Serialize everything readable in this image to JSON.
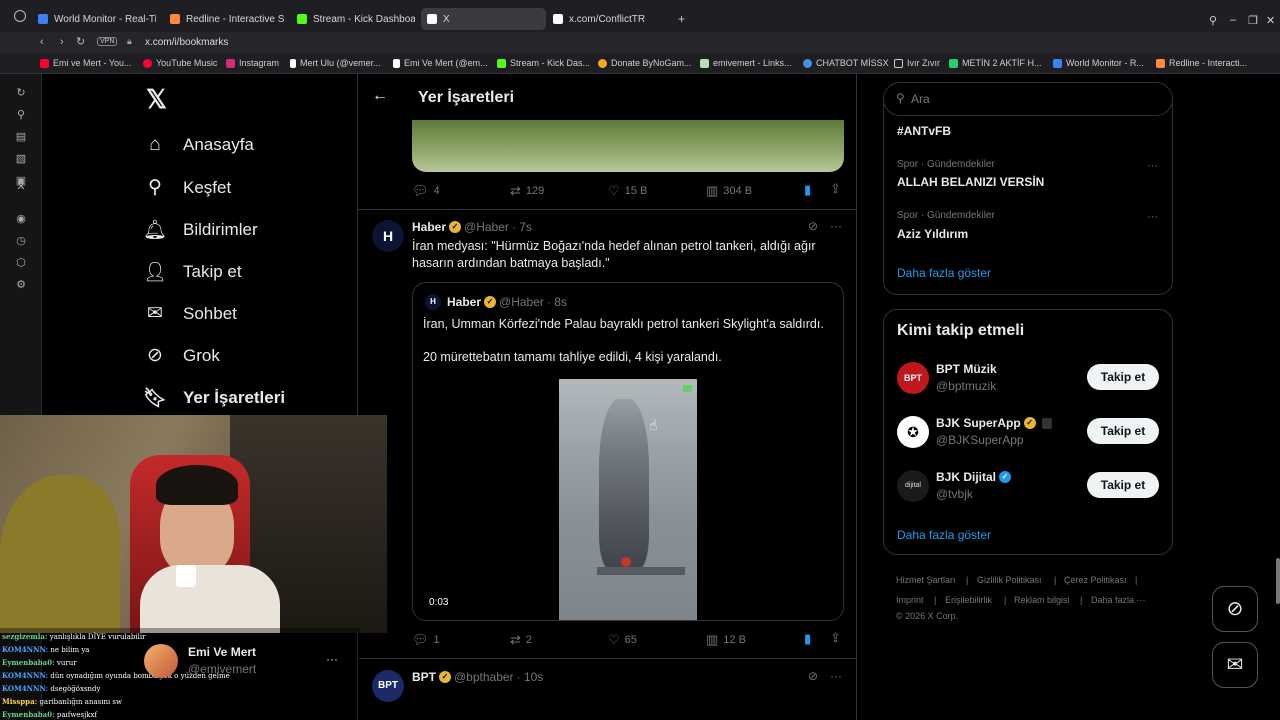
{
  "browser": {
    "tabs": [
      {
        "label": "World Monitor - Real-Tim",
        "color": "#3b82f6"
      },
      {
        "label": "Redline - Interactive Strat",
        "color": "#ff8a3d"
      },
      {
        "label": "Stream - Kick Dashboard",
        "color": "#53fc18"
      },
      {
        "label": "X",
        "color": "#ffffff"
      },
      {
        "label": "x.com/ConflictTR",
        "color": "#ffffff"
      }
    ],
    "new_tab": "+",
    "url": "x.com/i/bookmarks",
    "vpn": "VPN",
    "bookmarks": [
      {
        "label": "Emi ve Mert - You...",
        "color": "#ff0033"
      },
      {
        "label": "YouTube Music",
        "color": "#ff0033"
      },
      {
        "label": "Instagram",
        "color": "#d62976"
      },
      {
        "label": "Mert Ulu (@vemer...",
        "color": "#ffffff"
      },
      {
        "label": "Emi Ve Mert (@em...",
        "color": "#ffffff"
      },
      {
        "label": "Stream - Kick Das...",
        "color": "#53fc18"
      },
      {
        "label": "Donate ByNoGam...",
        "color": "#f5a623"
      },
      {
        "label": "emivemert - Links...",
        "color": "#b4e0b4"
      },
      {
        "label": "CHATBOT MİSSX",
        "color": "#4a90e2"
      },
      {
        "label": "Ivır Zıvır",
        "color": "#cccccc"
      },
      {
        "label": "METİN 2 AKTİF H...",
        "color": "#2ecc71"
      },
      {
        "label": "World Monitor - R...",
        "color": "#3b82f6"
      },
      {
        "label": "Redline - Interacti...",
        "color": "#ff8a3d"
      }
    ]
  },
  "nav": {
    "items": [
      {
        "label": "Anasayfa",
        "icon": "⌂"
      },
      {
        "label": "Keşfet",
        "icon": "⚲"
      },
      {
        "label": "Bildirimler",
        "icon": "🔔︎"
      },
      {
        "label": "Takip et",
        "icon": "👤︎"
      },
      {
        "label": "Sohbet",
        "icon": "✉"
      },
      {
        "label": "Grok",
        "icon": "⊘"
      },
      {
        "label": "Yer İşaretleri",
        "icon": "🔖︎"
      }
    ],
    "profile_name": "Emi Ve Mert",
    "profile_handle": "@emivemert",
    "more": "···"
  },
  "header": {
    "back": "←",
    "title": "Yer İşaretleri"
  },
  "post1": {
    "replies": "4",
    "reposts": "129",
    "likes": "15 B",
    "views": "304 B"
  },
  "post2": {
    "name": "Haber",
    "handle": "@Haber",
    "time": "· 7s",
    "text": "İran medyası: \"Hürmüz Boğazı'nda hedef alınan petrol tankeri, aldığı ağır hasarın ardından batmaya başladı.\"",
    "quote": {
      "name": "Haber",
      "handle": "@Haber",
      "time": "· 8s",
      "text1": "İran, Umman Körfezi'nde Palau bayraklı petrol tankeri Skylight'a saldırdı.",
      "text2": "20 mürettebatın tamamı tahliye edildi, 4 kişi yaralandı.",
      "video_time": "0:03"
    },
    "replies": "1",
    "reposts": "2",
    "likes": "65",
    "views": "12 B"
  },
  "post3": {
    "name": "BPT",
    "handle": "@bpthaber",
    "time": "· 10s"
  },
  "search": {
    "placeholder": "Ara"
  },
  "trends": {
    "top": "#ANTvFB",
    "items": [
      {
        "category": "Spor · Gündemdekiler",
        "name": "ALLAH BELANIZI VERSİN"
      },
      {
        "category": "Spor · Gündemdekiler",
        "name": "Aziz Yıldırım"
      }
    ],
    "show_more": "Daha fazla göster"
  },
  "who_to_follow": {
    "title": "Kimi takip etmeli",
    "accounts": [
      {
        "name": "BPT Müzik",
        "handle": "@bptmuzik",
        "button": "Takip et"
      },
      {
        "name": "BJK SuperApp",
        "handle": "@BJKSuperApp",
        "button": "Takip et"
      },
      {
        "name": "BJK Dijital",
        "handle": "@tvbjk",
        "button": "Takip et"
      }
    ],
    "show_more": "Daha fazla göster"
  },
  "footer": {
    "links": [
      "Hizmet Şartları",
      "Gizlilik Politikası",
      "Çerez Politikası",
      "Imprint",
      "Erişilebilirlik",
      "Reklam bilgisi",
      "Daha fazla ···"
    ],
    "copyright": "© 2026 X Corp."
  },
  "chat": [
    {
      "user": "sezgizemla:",
      "msg": "yanlışlıkla DİYE vurulabilir"
    },
    {
      "user": "KOM4NNN:",
      "msg": "ne bilim ya"
    },
    {
      "user": "Eymenbaba0:",
      "msg": "vurur"
    },
    {
      "user": "KOM4NNN:",
      "msg": "dün oynadığım oyunda bomba yok o yüzden gelme"
    },
    {
      "user": "KOM4NNN:",
      "msg": "dsegöğöxsndy"
    },
    {
      "user": "Missppa:",
      "msg": "garibanlığın anasını sw"
    },
    {
      "user": "Eymenbaba0:",
      "msg": "paıfwesjkxf"
    }
  ]
}
